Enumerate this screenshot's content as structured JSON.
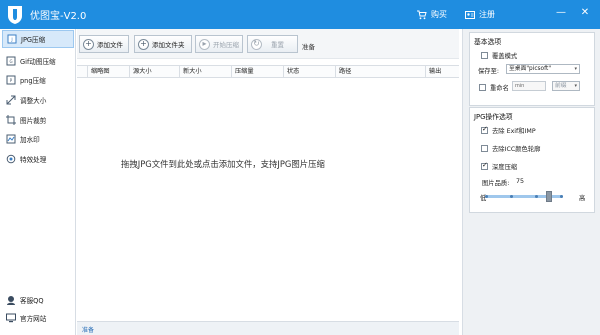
{
  "app": {
    "title": "优图宝-V2.0",
    "brand_color": "#1f8de0"
  },
  "titlebar": {
    "buy_label": "购买",
    "register_label": "注册",
    "minimize": "—",
    "close": "✕"
  },
  "sidebar": {
    "items": [
      {
        "label": "JPG压缩",
        "icon": "jpg-icon"
      },
      {
        "label": "Gif动图压缩",
        "icon": "gif-icon"
      },
      {
        "label": "png压缩",
        "icon": "png-icon"
      },
      {
        "label": "调整大小",
        "icon": "resize-icon"
      },
      {
        "label": "图片裁剪",
        "icon": "crop-icon"
      },
      {
        "label": "加水印",
        "icon": "watermark-icon"
      },
      {
        "label": "特效处理",
        "icon": "effects-icon"
      }
    ],
    "bottom": [
      {
        "label": "客服QQ",
        "icon": "customer-service-icon"
      },
      {
        "label": "官方网站",
        "icon": "website-icon"
      }
    ]
  },
  "toolbar": {
    "add_file": "添加文件",
    "add_folder": "添加文件夹",
    "start_compress": "开始压缩",
    "reset": "重置",
    "status": "准备"
  },
  "table": {
    "columns": [
      "缩略图",
      "源大小",
      "新大小",
      "压缩量",
      "状态",
      "路径",
      "输出"
    ],
    "drop_hint": "拖拽JPG文件到此处或点击添加文件，支持JPG图片压缩"
  },
  "statusbar": {
    "text": "准备"
  },
  "basic_options": {
    "title": "基本选项",
    "overwrite_label": "覆盖模式",
    "overwrite_checked": false,
    "save_to_label": "保存至:",
    "save_to_value": "至桌面\"picsoft\"",
    "rename_label": "重命名",
    "rename_checked": false,
    "rename_placeholder": "min",
    "rename_position": "前缀"
  },
  "jpg_options": {
    "title": "JPG操作选项",
    "remove_exif_label": "去除 Exif和IMP",
    "remove_exif_checked": true,
    "remove_icc_label": "去除ICC颜色轮廓",
    "remove_icc_checked": false,
    "deep_compress_label": "深度压缩",
    "deep_compress_checked": true,
    "quality_label": "图片品质:",
    "quality_value": "75",
    "low_label": "低",
    "high_label": "高"
  }
}
